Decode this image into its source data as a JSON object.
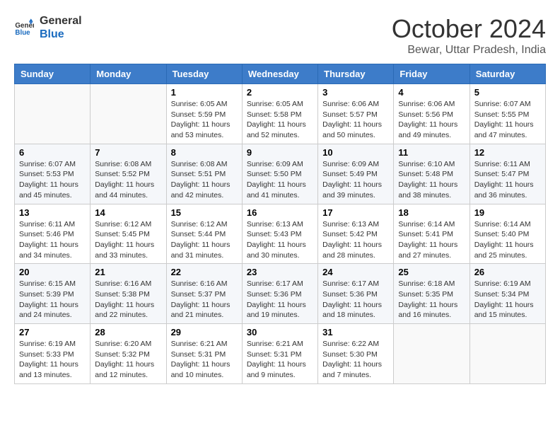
{
  "logo": {
    "line1": "General",
    "line2": "Blue"
  },
  "title": "October 2024",
  "subtitle": "Bewar, Uttar Pradesh, India",
  "days_header": [
    "Sunday",
    "Monday",
    "Tuesday",
    "Wednesday",
    "Thursday",
    "Friday",
    "Saturday"
  ],
  "weeks": [
    [
      {
        "day": "",
        "sunrise": "",
        "sunset": "",
        "daylight": ""
      },
      {
        "day": "",
        "sunrise": "",
        "sunset": "",
        "daylight": ""
      },
      {
        "day": "1",
        "sunrise": "Sunrise: 6:05 AM",
        "sunset": "Sunset: 5:59 PM",
        "daylight": "Daylight: 11 hours and 53 minutes."
      },
      {
        "day": "2",
        "sunrise": "Sunrise: 6:05 AM",
        "sunset": "Sunset: 5:58 PM",
        "daylight": "Daylight: 11 hours and 52 minutes."
      },
      {
        "day": "3",
        "sunrise": "Sunrise: 6:06 AM",
        "sunset": "Sunset: 5:57 PM",
        "daylight": "Daylight: 11 hours and 50 minutes."
      },
      {
        "day": "4",
        "sunrise": "Sunrise: 6:06 AM",
        "sunset": "Sunset: 5:56 PM",
        "daylight": "Daylight: 11 hours and 49 minutes."
      },
      {
        "day": "5",
        "sunrise": "Sunrise: 6:07 AM",
        "sunset": "Sunset: 5:55 PM",
        "daylight": "Daylight: 11 hours and 47 minutes."
      }
    ],
    [
      {
        "day": "6",
        "sunrise": "Sunrise: 6:07 AM",
        "sunset": "Sunset: 5:53 PM",
        "daylight": "Daylight: 11 hours and 45 minutes."
      },
      {
        "day": "7",
        "sunrise": "Sunrise: 6:08 AM",
        "sunset": "Sunset: 5:52 PM",
        "daylight": "Daylight: 11 hours and 44 minutes."
      },
      {
        "day": "8",
        "sunrise": "Sunrise: 6:08 AM",
        "sunset": "Sunset: 5:51 PM",
        "daylight": "Daylight: 11 hours and 42 minutes."
      },
      {
        "day": "9",
        "sunrise": "Sunrise: 6:09 AM",
        "sunset": "Sunset: 5:50 PM",
        "daylight": "Daylight: 11 hours and 41 minutes."
      },
      {
        "day": "10",
        "sunrise": "Sunrise: 6:09 AM",
        "sunset": "Sunset: 5:49 PM",
        "daylight": "Daylight: 11 hours and 39 minutes."
      },
      {
        "day": "11",
        "sunrise": "Sunrise: 6:10 AM",
        "sunset": "Sunset: 5:48 PM",
        "daylight": "Daylight: 11 hours and 38 minutes."
      },
      {
        "day": "12",
        "sunrise": "Sunrise: 6:11 AM",
        "sunset": "Sunset: 5:47 PM",
        "daylight": "Daylight: 11 hours and 36 minutes."
      }
    ],
    [
      {
        "day": "13",
        "sunrise": "Sunrise: 6:11 AM",
        "sunset": "Sunset: 5:46 PM",
        "daylight": "Daylight: 11 hours and 34 minutes."
      },
      {
        "day": "14",
        "sunrise": "Sunrise: 6:12 AM",
        "sunset": "Sunset: 5:45 PM",
        "daylight": "Daylight: 11 hours and 33 minutes."
      },
      {
        "day": "15",
        "sunrise": "Sunrise: 6:12 AM",
        "sunset": "Sunset: 5:44 PM",
        "daylight": "Daylight: 11 hours and 31 minutes."
      },
      {
        "day": "16",
        "sunrise": "Sunrise: 6:13 AM",
        "sunset": "Sunset: 5:43 PM",
        "daylight": "Daylight: 11 hours and 30 minutes."
      },
      {
        "day": "17",
        "sunrise": "Sunrise: 6:13 AM",
        "sunset": "Sunset: 5:42 PM",
        "daylight": "Daylight: 11 hours and 28 minutes."
      },
      {
        "day": "18",
        "sunrise": "Sunrise: 6:14 AM",
        "sunset": "Sunset: 5:41 PM",
        "daylight": "Daylight: 11 hours and 27 minutes."
      },
      {
        "day": "19",
        "sunrise": "Sunrise: 6:14 AM",
        "sunset": "Sunset: 5:40 PM",
        "daylight": "Daylight: 11 hours and 25 minutes."
      }
    ],
    [
      {
        "day": "20",
        "sunrise": "Sunrise: 6:15 AM",
        "sunset": "Sunset: 5:39 PM",
        "daylight": "Daylight: 11 hours and 24 minutes."
      },
      {
        "day": "21",
        "sunrise": "Sunrise: 6:16 AM",
        "sunset": "Sunset: 5:38 PM",
        "daylight": "Daylight: 11 hours and 22 minutes."
      },
      {
        "day": "22",
        "sunrise": "Sunrise: 6:16 AM",
        "sunset": "Sunset: 5:37 PM",
        "daylight": "Daylight: 11 hours and 21 minutes."
      },
      {
        "day": "23",
        "sunrise": "Sunrise: 6:17 AM",
        "sunset": "Sunset: 5:36 PM",
        "daylight": "Daylight: 11 hours and 19 minutes."
      },
      {
        "day": "24",
        "sunrise": "Sunrise: 6:17 AM",
        "sunset": "Sunset: 5:36 PM",
        "daylight": "Daylight: 11 hours and 18 minutes."
      },
      {
        "day": "25",
        "sunrise": "Sunrise: 6:18 AM",
        "sunset": "Sunset: 5:35 PM",
        "daylight": "Daylight: 11 hours and 16 minutes."
      },
      {
        "day": "26",
        "sunrise": "Sunrise: 6:19 AM",
        "sunset": "Sunset: 5:34 PM",
        "daylight": "Daylight: 11 hours and 15 minutes."
      }
    ],
    [
      {
        "day": "27",
        "sunrise": "Sunrise: 6:19 AM",
        "sunset": "Sunset: 5:33 PM",
        "daylight": "Daylight: 11 hours and 13 minutes."
      },
      {
        "day": "28",
        "sunrise": "Sunrise: 6:20 AM",
        "sunset": "Sunset: 5:32 PM",
        "daylight": "Daylight: 11 hours and 12 minutes."
      },
      {
        "day": "29",
        "sunrise": "Sunrise: 6:21 AM",
        "sunset": "Sunset: 5:31 PM",
        "daylight": "Daylight: 11 hours and 10 minutes."
      },
      {
        "day": "30",
        "sunrise": "Sunrise: 6:21 AM",
        "sunset": "Sunset: 5:31 PM",
        "daylight": "Daylight: 11 hours and 9 minutes."
      },
      {
        "day": "31",
        "sunrise": "Sunrise: 6:22 AM",
        "sunset": "Sunset: 5:30 PM",
        "daylight": "Daylight: 11 hours and 7 minutes."
      },
      {
        "day": "",
        "sunrise": "",
        "sunset": "",
        "daylight": ""
      },
      {
        "day": "",
        "sunrise": "",
        "sunset": "",
        "daylight": ""
      }
    ]
  ]
}
